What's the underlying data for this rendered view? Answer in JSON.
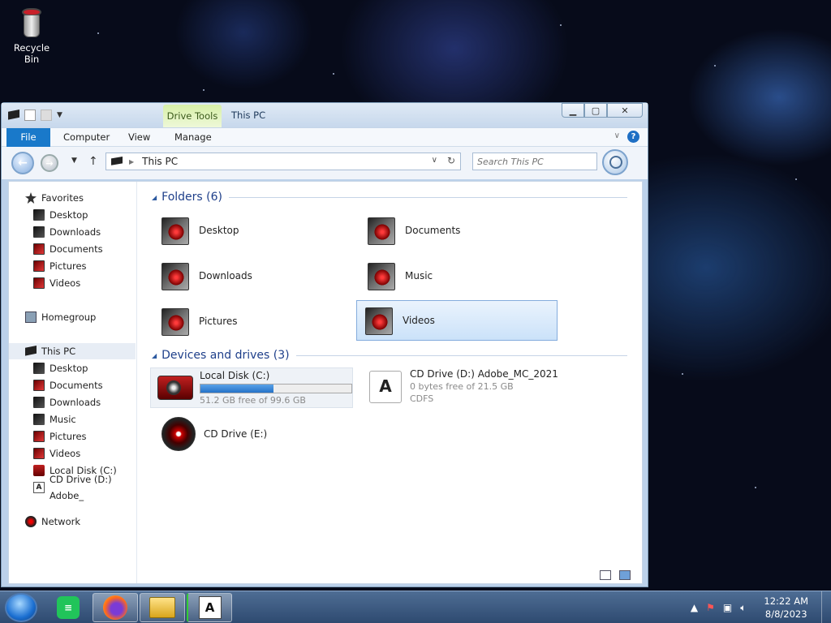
{
  "desktop": {
    "recycle_bin_label": "Recycle Bin"
  },
  "window": {
    "title": "This PC",
    "contextual_tab": "Drive Tools",
    "ribbon_tabs": [
      "File",
      "Computer",
      "View",
      "Manage"
    ],
    "address_path": "This PC",
    "search_placeholder": "Search This PC"
  },
  "nav_tree": {
    "favorites": "Favorites",
    "favorites_items": [
      "Desktop",
      "Downloads",
      "Documents",
      "Pictures",
      "Videos"
    ],
    "homegroup": "Homegroup",
    "this_pc": "This PC",
    "this_pc_items": [
      "Desktop",
      "Documents",
      "Downloads",
      "Music",
      "Pictures",
      "Videos",
      "Local Disk (C:)",
      "CD Drive (D:) Adobe_"
    ],
    "network": "Network"
  },
  "folders_group": {
    "title": "Folders (6)",
    "items": [
      "Desktop",
      "Documents",
      "Downloads",
      "Music",
      "Pictures",
      "Videos"
    ]
  },
  "devices_group": {
    "title": "Devices and drives (3)",
    "drives": [
      {
        "name": "Local Disk (C:)",
        "free_text": "51.2 GB free of 99.6 GB",
        "used_fraction": 0.486
      },
      {
        "name": "CD Drive (D:) Adobe_MC_2021",
        "free_text": "0 bytes free of 21.5 GB",
        "fs": "CDFS"
      },
      {
        "name": "CD Drive (E:)"
      }
    ]
  },
  "taskbar": {
    "apps": [
      "feedly",
      "firefox",
      "file-explorer",
      "adobe-installer"
    ],
    "time": "12:22 AM",
    "date": "8/8/2023"
  },
  "colors": {
    "file_tab": "#1979ca",
    "selection": "#cbe2f9",
    "taskbar": "#2e4a70"
  }
}
